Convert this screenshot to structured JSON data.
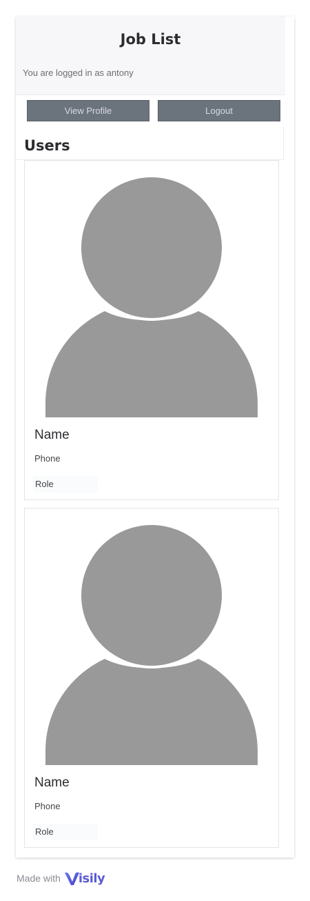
{
  "header": {
    "title": "Job List",
    "login_text": "You are logged in as antony"
  },
  "actions": {
    "view_profile": "View Profile",
    "logout": "Logout"
  },
  "users": {
    "title": "Users",
    "cards": [
      {
        "name": "Name",
        "phone": "Phone",
        "role": "Role"
      },
      {
        "name": "Name",
        "phone": "Phone",
        "role": "Role"
      }
    ]
  },
  "footer": {
    "made_with": "Made with",
    "brand": "isily"
  },
  "colors": {
    "button_bg": "#6b737d",
    "avatar_gray": "#999999",
    "brand": "#5b5bd6"
  },
  "icons": {
    "avatar": "user-avatar-icon",
    "brand_logo": "visily-logo-icon"
  }
}
